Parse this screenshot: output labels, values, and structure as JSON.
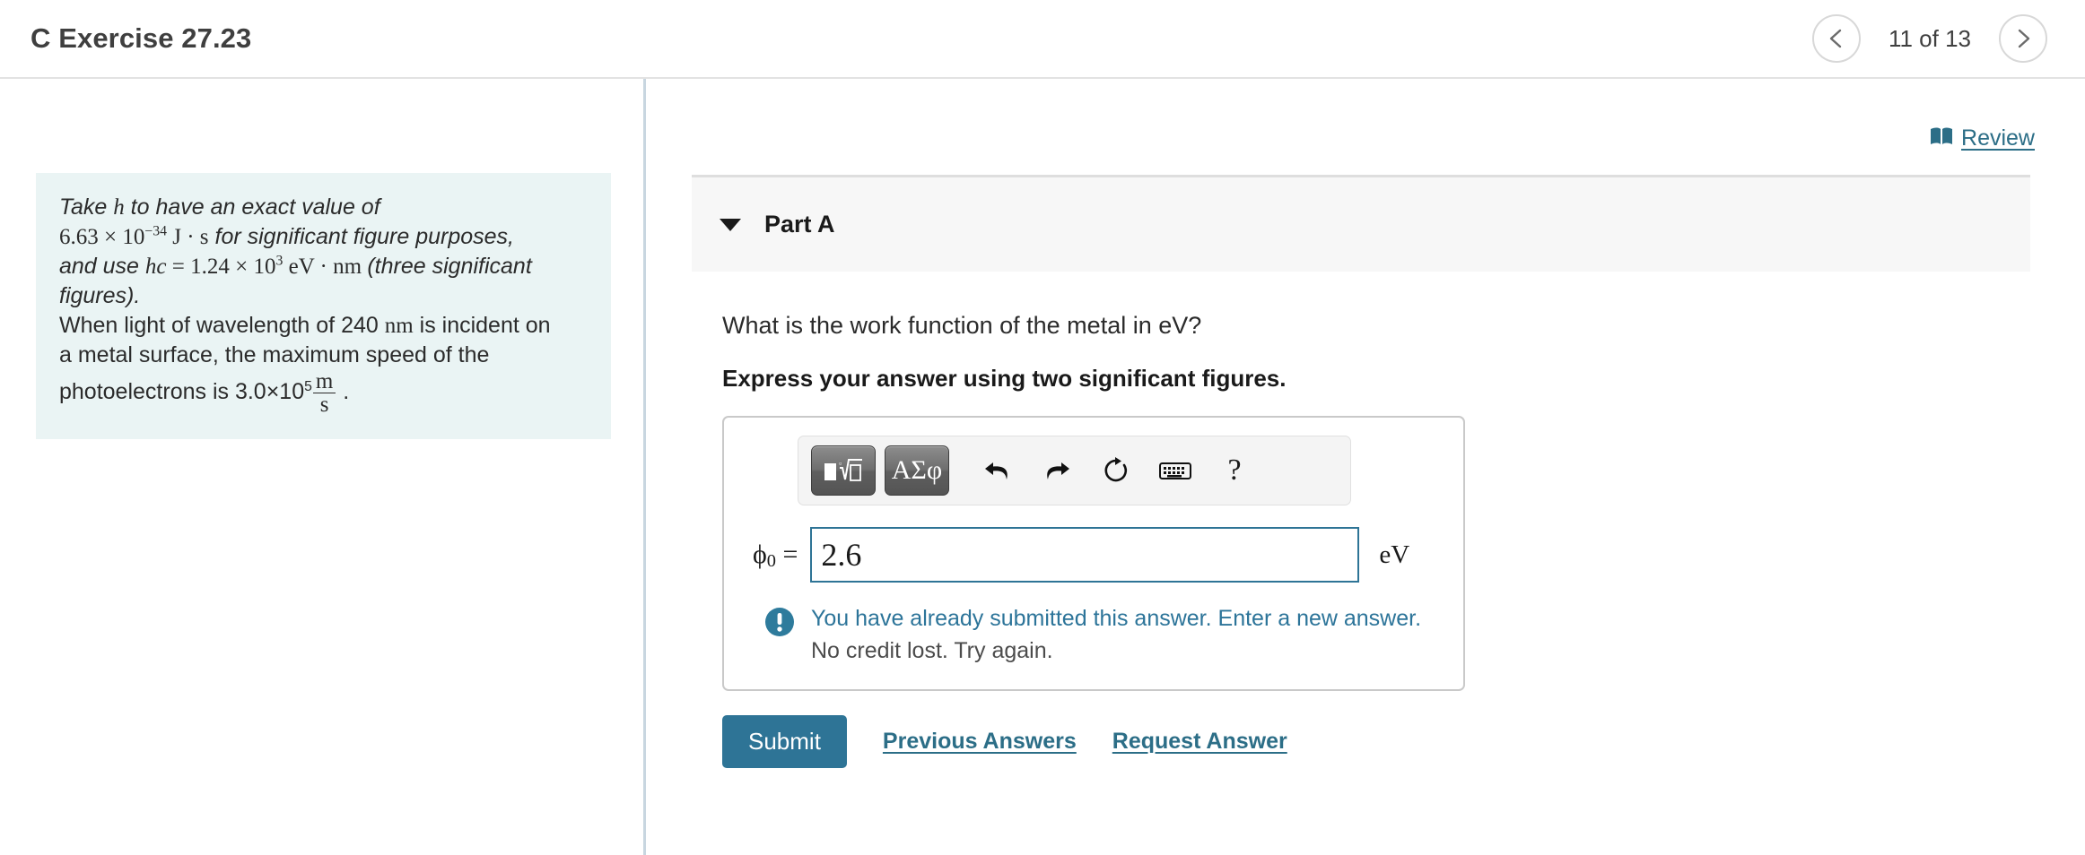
{
  "header": {
    "title": "C Exercise 27.23",
    "prev_icon": "chevron-left-icon",
    "next_icon": "chevron-right-icon",
    "pagination": "11 of 13"
  },
  "problem": {
    "line1_a": "Take ",
    "line1_h": "h",
    "line1_b": " to have an exact value of",
    "value_h": "6.63 × 10",
    "value_h_exp": "−34",
    "units_h": " J · s",
    "phrase1": " for significant figure purposes,",
    "phrase2": "and use ",
    "hc_sym": "hc",
    "hc_eq": " = 1.24 × 10",
    "hc_exp": "3",
    "hc_units": " eV · nm ",
    "phrase3": "(three significant figures).",
    "body_line1": "When light of wavelength of 240 ",
    "body_nm": "nm",
    "body_line1b": " is incident on",
    "body_line2": "a metal surface, the maximum speed of the",
    "body_line3": "photoelectrons is 3.0×10",
    "body_exp": "5",
    "body_units_num": "m",
    "body_units_den": "s",
    "body_end": " ."
  },
  "review": {
    "icon": "book-icon",
    "label": "Review"
  },
  "part": {
    "label": "Part A",
    "caret_icon": "caret-down-icon",
    "question": "What is the work function of the metal in eV?",
    "instruction": "Express your answer using two significant figures."
  },
  "toolbar": {
    "template_icon": "math-template-icon",
    "greek_label": "ΑΣφ",
    "undo_icon": "undo-arrow-icon",
    "redo_icon": "redo-arrow-icon",
    "reset_icon": "reset-circle-icon",
    "keyboard_icon": "keyboard-icon",
    "help_label": "?"
  },
  "answer": {
    "variable": "ϕ",
    "subscript": "0",
    "equals": " =",
    "value": "2.6",
    "placeholder": "",
    "unit": "eV"
  },
  "alert": {
    "icon": "exclamation-circle-icon",
    "primary": "You have already submitted this answer. Enter a new answer.",
    "secondary": "No credit lost. Try again."
  },
  "actions": {
    "submit_label": "Submit",
    "previous_answers_label": "Previous Answers",
    "request_answer_label": "Request Answer"
  },
  "colors": {
    "accent_teal": "#2e7496",
    "link_teal": "#2c6e87",
    "problem_bg": "#eaf4f4",
    "part_bg": "#f7f7f7"
  }
}
